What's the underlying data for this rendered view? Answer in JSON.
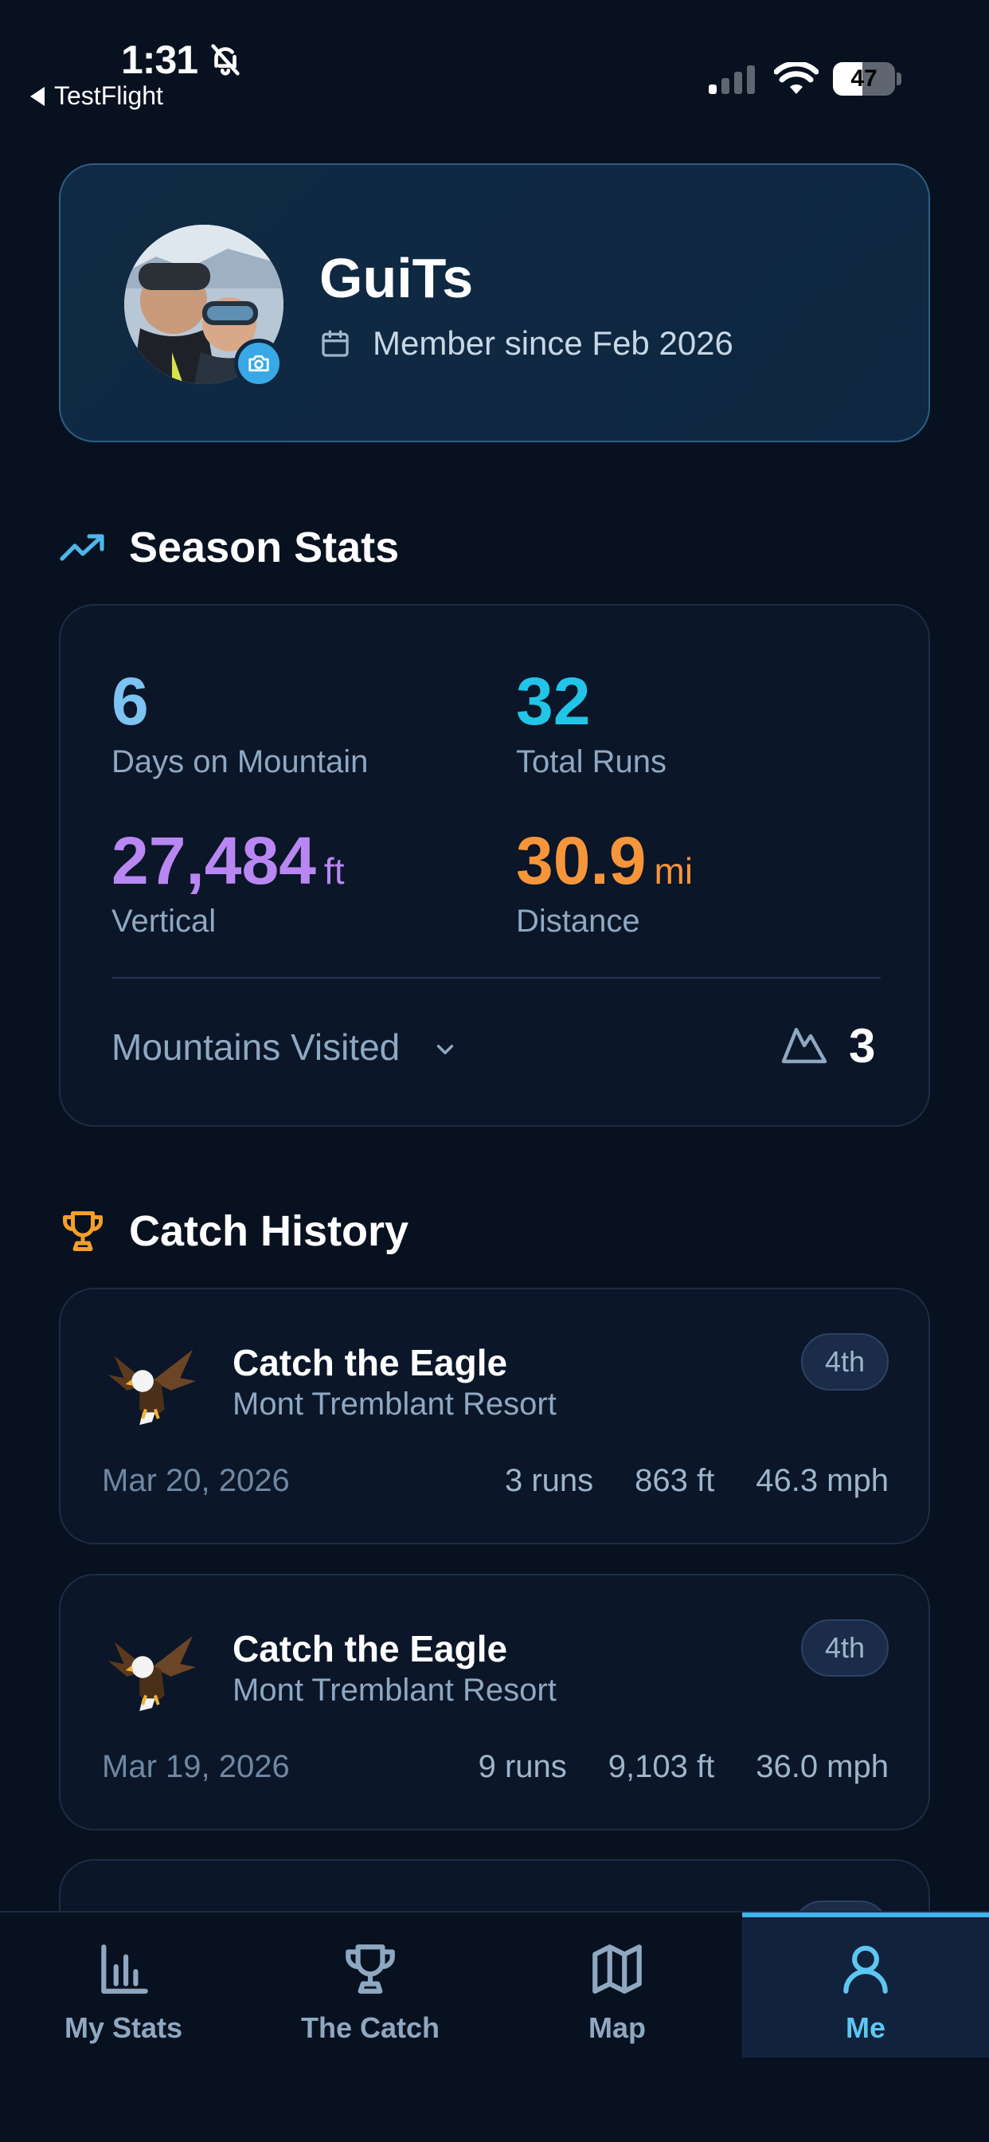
{
  "status_bar": {
    "time": "1:31",
    "back_app": "TestFlight",
    "battery_percent": "47",
    "battery_level": 0.47
  },
  "profile": {
    "username": "GuiTs",
    "member_since": "Member since Feb 2026"
  },
  "season_stats": {
    "title": "Season Stats",
    "days_value": "6",
    "days_label": "Days on Mountain",
    "runs_value": "32",
    "runs_label": "Total Runs",
    "vertical_value": "27,484",
    "vertical_unit": "ft",
    "vertical_label": "Vertical",
    "distance_value": "30.9",
    "distance_unit": "mi",
    "distance_label": "Distance",
    "mountains_label": "Mountains Visited",
    "mountains_count": "3",
    "colors": {
      "days": "#7cc3f2",
      "runs": "#22c4e8",
      "vertical": "#b987f2",
      "distance": "#f7953b"
    }
  },
  "catch_history": {
    "title": "Catch History",
    "items": [
      {
        "title": "Catch the Eagle",
        "resort": "Mont Tremblant Resort",
        "rank": "4th",
        "date": "Mar 20, 2026",
        "runs": "3 runs",
        "vertical": "863 ft",
        "speed": "46.3 mph"
      },
      {
        "title": "Catch the Eagle",
        "resort": "Mont Tremblant Resort",
        "rank": "4th",
        "date": "Mar 19, 2026",
        "runs": "9 runs",
        "vertical": "9,103 ft",
        "speed": "36.0 mph"
      }
    ]
  },
  "bottom_nav": {
    "items": [
      {
        "label": "My Stats",
        "icon": "bar-chart-icon"
      },
      {
        "label": "The Catch",
        "icon": "trophy-icon"
      },
      {
        "label": "Map",
        "icon": "map-icon"
      },
      {
        "label": "Me",
        "icon": "person-icon"
      }
    ],
    "active_index": 3,
    "accent": "#3fb3ea"
  }
}
